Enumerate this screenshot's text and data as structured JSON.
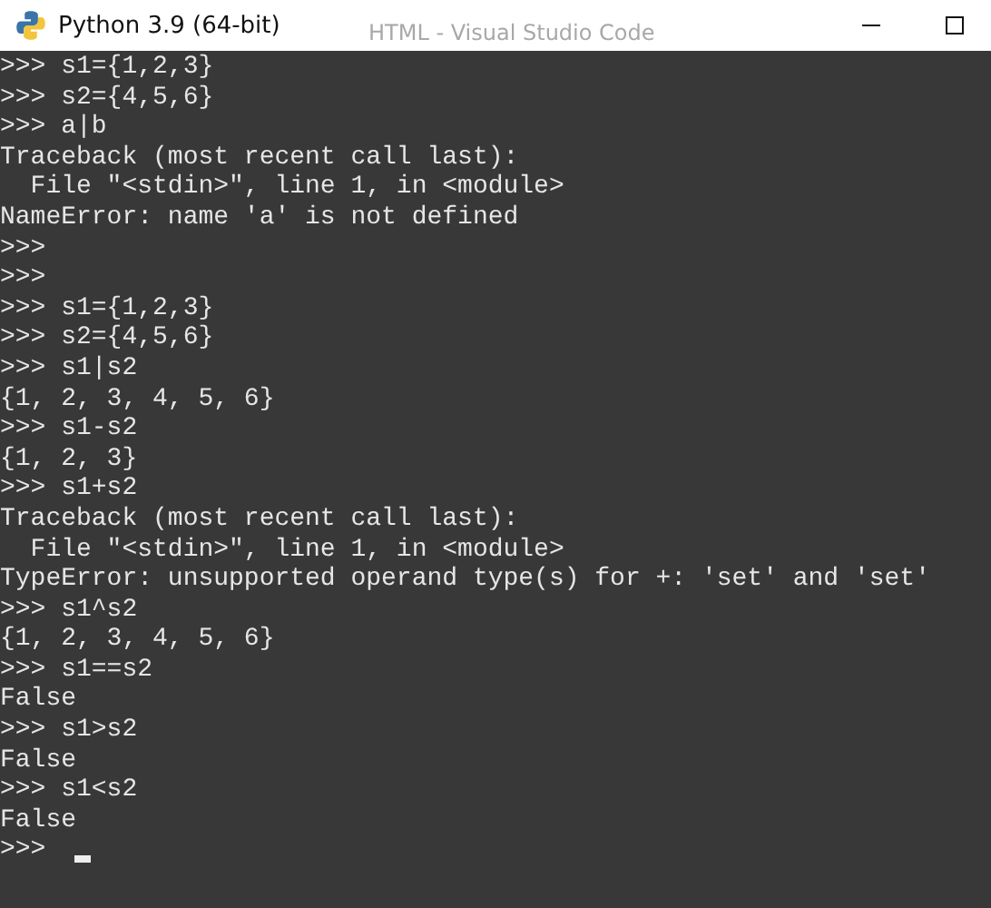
{
  "window": {
    "title": "Python 3.9 (64-bit)",
    "background_title": "HTML - Visual Studio Code"
  },
  "console": {
    "lines": [
      ">>> s1={1,2,3}",
      ">>> s2={4,5,6}",
      ">>> a|b",
      "Traceback (most recent call last):",
      "  File \"<stdin>\", line 1, in <module>",
      "NameError: name 'a' is not defined",
      ">>>",
      ">>>",
      ">>> s1={1,2,3}",
      ">>> s2={4,5,6}",
      ">>> s1|s2",
      "{1, 2, 3, 4, 5, 6}",
      ">>> s1-s2",
      "{1, 2, 3}",
      ">>> s1+s2",
      "Traceback (most recent call last):",
      "  File \"<stdin>\", line 1, in <module>",
      "TypeError: unsupported operand type(s) for +: 'set' and 'set'",
      ">>> s1^s2",
      "{1, 2, 3, 4, 5, 6}",
      ">>> s1==s2",
      "False",
      ">>> s1>s2",
      "False",
      ">>> s1<s2",
      "False"
    ],
    "prompt": ">>>"
  }
}
